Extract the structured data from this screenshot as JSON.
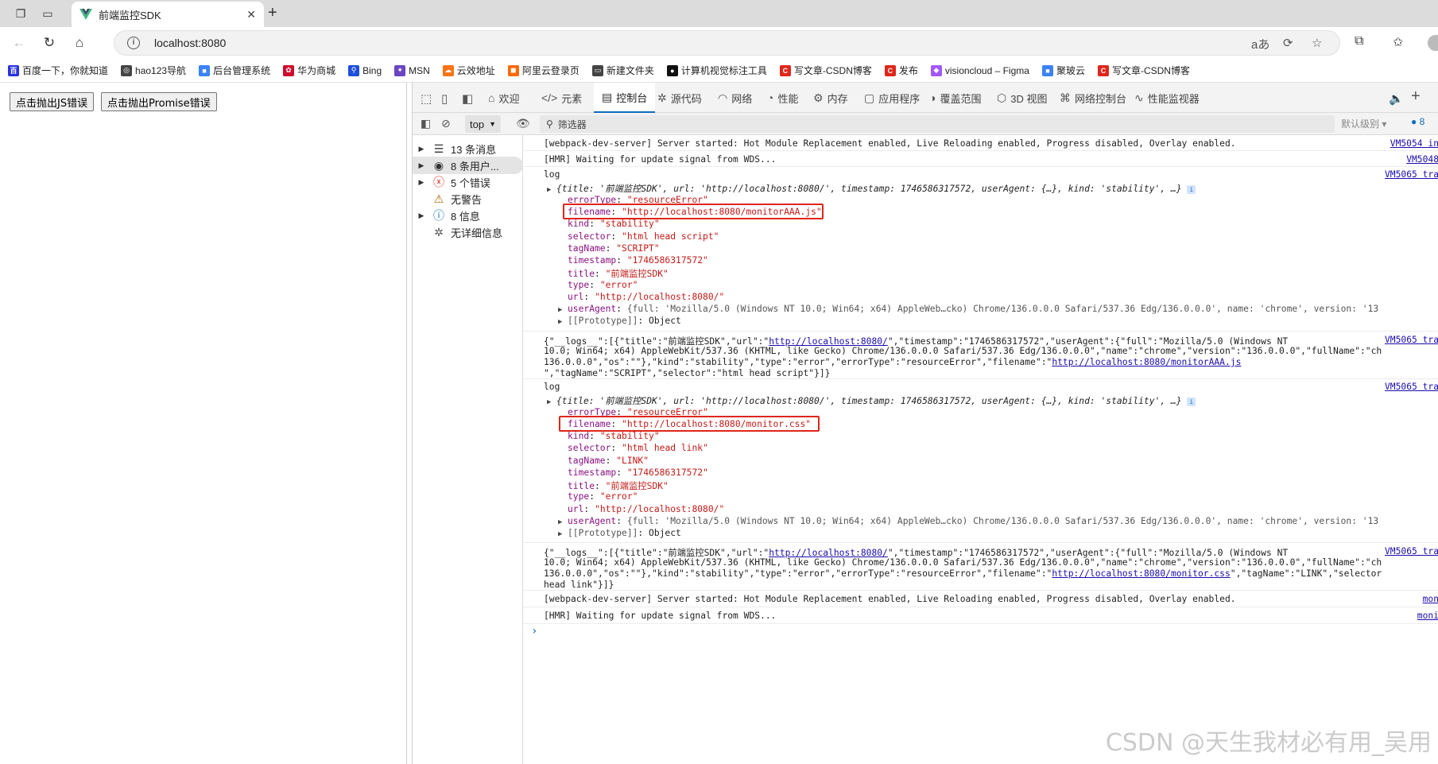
{
  "browser": {
    "tab_title": "前端监控SDK",
    "url": "localhost:8080"
  },
  "bookmarks": [
    {
      "label": "百度一下，你就知道",
      "icon": "baidu-icon",
      "color": "#2932e1"
    },
    {
      "label": "hao123导航",
      "icon": "globe-icon",
      "color": "#444444"
    },
    {
      "label": "后台管理系统",
      "icon": "bookmark-icon",
      "color": "#3b82f6"
    },
    {
      "label": "华为商城",
      "icon": "huawei-icon",
      "color": "#cf0a2c"
    },
    {
      "label": "Bing",
      "icon": "search-icon",
      "color": "#1d4ed8"
    },
    {
      "label": "MSN",
      "icon": "msn-icon",
      "color": "#6b46c1"
    },
    {
      "label": "云效地址",
      "icon": "cloud-icon",
      "color": "#f97316"
    },
    {
      "label": "阿里云登录页",
      "icon": "aliyun-icon",
      "color": "#ff6a00"
    },
    {
      "label": "新建文件夹",
      "icon": "folder-icon",
      "color": "#444444"
    },
    {
      "label": "计算机视觉标注工具",
      "icon": "github-icon",
      "color": "#111111"
    },
    {
      "label": "写文章-CSDN博客",
      "icon": "csdn-icon",
      "color": "#e0261b"
    },
    {
      "label": "发布",
      "icon": "csdn-icon",
      "color": "#e0261b"
    },
    {
      "label": "visioncloud – Figma",
      "icon": "figma-icon",
      "color": "#a259ff"
    },
    {
      "label": "聚玻云",
      "icon": "bookmark-icon",
      "color": "#3b82f6"
    },
    {
      "label": "写文章-CSDN博客",
      "icon": "csdn-icon",
      "color": "#e0261b"
    }
  ],
  "page": {
    "btn_js": "点击抛出JS错误",
    "btn_promise": "点击抛出Promise错误"
  },
  "devtools": {
    "tabs": [
      {
        "label": "欢迎",
        "icon": "home-icon"
      },
      {
        "label": "元素",
        "icon": "code-icon"
      },
      {
        "label": "控制台",
        "icon": "console-icon"
      },
      {
        "label": "源代码",
        "icon": "bug-icon"
      },
      {
        "label": "网络",
        "icon": "wifi-icon"
      },
      {
        "label": "性能",
        "icon": "performance-icon"
      },
      {
        "label": "内存",
        "icon": "memory-icon"
      },
      {
        "label": "应用程序",
        "icon": "application-icon"
      },
      {
        "label": "覆盖范围",
        "icon": "coverage-icon"
      },
      {
        "label": "3D 视图",
        "icon": "cube-icon"
      },
      {
        "label": "网络控制台",
        "icon": "network-console-icon"
      },
      {
        "label": "性能监视器",
        "icon": "monitor-icon"
      }
    ],
    "context": "top",
    "filter_placeholder": "筛选器",
    "level": "默认级别",
    "issues_count": "8",
    "sidebar": [
      {
        "label": "13 条消息",
        "icon": "list-icon"
      },
      {
        "label": "8 条用户...",
        "icon": "user-icon"
      },
      {
        "label": "5 个错误",
        "icon": "error-icon"
      },
      {
        "label": "无警告",
        "icon": "warning-icon"
      },
      {
        "label": "8 信息",
        "icon": "info-icon"
      },
      {
        "label": "无详细信息",
        "icon": "verbose-icon"
      }
    ]
  },
  "console": {
    "m1": {
      "text": "[webpack-dev-server] Server started: Hot Module Replacement enabled, Live Reloading enabled, Progress disabled, Overlay enabled.",
      "src": "VM5054 in"
    },
    "m2": {
      "text": "[HMR] Waiting for update signal from WDS...",
      "src": "VM5048"
    },
    "log_label": "log",
    "log_src": "VM5065 tra",
    "summary_prefix": "{title: '前端监控SDK', url: 'http://localhost:8080/', timestamp: 1746586317572, userAgent: {…}, kind: 'stability', …}",
    "entry1": {
      "errorType": "\"resourceError\"",
      "filename": "\"http://localhost:8080/monitorAAA.js\"",
      "kind": "\"stability\"",
      "selector": "\"html head script\"",
      "tagName": "\"SCRIPT\"",
      "timestamp": "\"1746586317572\"",
      "title": "\"前端监控SDK\"",
      "type": "\"error\"",
      "url": "\"http://localhost:8080/\"",
      "userAgent": "{full: 'Mozilla/5.0 (Windows NT 10.0; Win64; x64) AppleWeb…cko) Chrome/136.0.0.0 Safari/537.36 Edg/136.0.0.0', name: 'chrome', version: '13",
      "prototype": "Object"
    },
    "json1": {
      "l1a": "{\"__logs__\":[{\"title\":\"前端监控SDK\",\"url\":\"",
      "l1link": "http://localhost:8080/",
      "l1b": "\",\"timestamp\":\"1746586317572\",\"userAgent\":{\"full\":\"Mozilla/5.0 (Windows NT",
      "l2": "10.0; Win64; x64) AppleWebKit/537.36 (KHTML, like Gecko) Chrome/136.0.0.0 Safari/537.36 Edg/136.0.0.0\",\"name\":\"chrome\",\"version\":\"136.0.0.0\",\"fullName\":\"ch",
      "l3a": "136.0.0.0\",\"os\":\"\"},\"kind\":\"stability\",\"type\":\"error\",\"errorType\":\"resourceError\",\"filename\":\"",
      "l3link": "http://localhost:8080/monitorAAA.js",
      "l4": "\",\"tagName\":\"SCRIPT\",\"selector\":\"html head script\"}]}",
      "src": "VM5065 tra"
    },
    "entry2": {
      "errorType": "\"resourceError\"",
      "filename": "\"http://localhost:8080/monitor.css\"",
      "kind": "\"stability\"",
      "selector": "\"html head link\"",
      "tagName": "\"LINK\"",
      "timestamp": "\"1746586317572\"",
      "title": "\"前端监控SDK\"",
      "type": "\"error\"",
      "url": "\"http://localhost:8080/\"",
      "userAgent": "{full: 'Mozilla/5.0 (Windows NT 10.0; Win64; x64) AppleWeb…cko) Chrome/136.0.0.0 Safari/537.36 Edg/136.0.0.0', name: 'chrome', version: '13",
      "prototype": "Object"
    },
    "json2": {
      "l1a": "{\"__logs__\":[{\"title\":\"前端监控SDK\",\"url\":\"",
      "l1link": "http://localhost:8080/",
      "l1b": "\",\"timestamp\":\"1746586317572\",\"userAgent\":{\"full\":\"Mozilla/5.0 (Windows NT",
      "l2": "10.0; Win64; x64) AppleWebKit/537.36 (KHTML, like Gecko) Chrome/136.0.0.0 Safari/537.36 Edg/136.0.0.0\",\"name\":\"chrome\",\"version\":\"136.0.0.0\",\"fullName\":\"ch",
      "l3a": "136.0.0.0\",\"os\":\"\"},\"kind\":\"stability\",\"type\":\"error\",\"errorType\":\"resourceError\",\"filename\":\"",
      "l3link": "http://localhost:8080/monitor.css",
      "l3b": "\",\"tagName\":\"LINK\",\"selector",
      "l4": "head link\"}]}",
      "src": "VM5065 tra"
    },
    "m3": {
      "text": "[webpack-dev-server] Server started: Hot Module Replacement enabled, Live Reloading enabled, Progress disabled, Overlay enabled.",
      "src": "mon"
    },
    "m4": {
      "text": "[HMR] Waiting for update signal from WDS...",
      "src": "moni"
    }
  },
  "watermark": "CSDN @天生我材必有用_吴用"
}
